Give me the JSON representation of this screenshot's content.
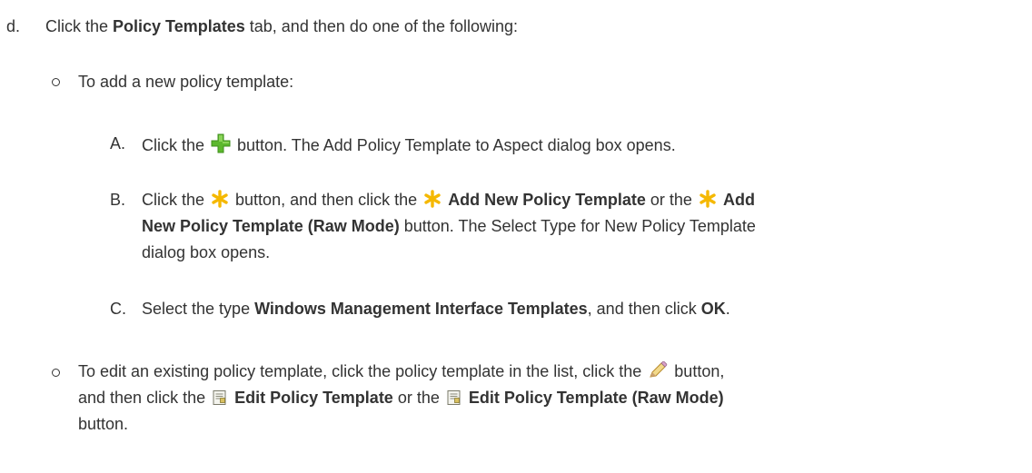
{
  "step_d": {
    "marker": "d.",
    "text_1": "Click the ",
    "bold_1": "Policy Templates",
    "text_2": " tab, and then do one of the following:"
  },
  "option_add": {
    "text": "To add a new policy template:",
    "steps": [
      {
        "marker": "A.",
        "text_1": "Click the ",
        "icon": "add-green-plus-icon",
        "text_2": " button. The Add Policy Template to Aspect dialog box opens."
      },
      {
        "marker": "B.",
        "text_1": "Click the ",
        "icon": "new-asterisk-icon",
        "text_2": " button, and then click the ",
        "bold_1": "Add New Policy Template",
        "text_3": " or the ",
        "bold_2a": "Add",
        "bold_2b": "New Policy Template (Raw Mode)",
        "text_4": " button. The Select Type for New Policy Template",
        "text_5": "dialog box opens."
      },
      {
        "marker": "C.",
        "text_1": "Select the type ",
        "bold_1": "Windows Management Interface Templates",
        "text_2": ", and then click ",
        "bold_2": "OK",
        "text_3": "."
      }
    ]
  },
  "option_edit": {
    "text_1": "To edit an existing policy template, click the policy template in the list, click the ",
    "icon_pencil": "pencil-icon",
    "text_2": " button,",
    "text_3": "and then click the ",
    "icon_template": "policy-template-icon",
    "bold_1": "Edit Policy Template",
    "text_4": " or the ",
    "bold_2": "Edit Policy Template (Raw Mode)",
    "text_5": "button."
  },
  "colors": {
    "text": "#333333",
    "plus_green": "#5cb82e",
    "asterisk_yellow": "#f5b800"
  }
}
